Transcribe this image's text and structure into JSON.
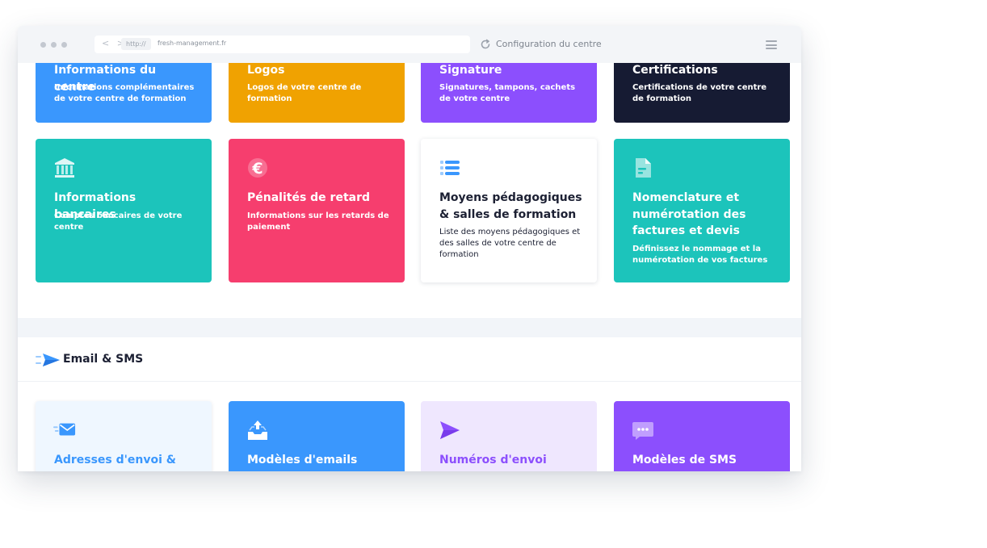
{
  "browser": {
    "protocol": "http://",
    "domain": "fresh-management.fr",
    "page_title": "Configuration du centre"
  },
  "colors": {
    "blue": "#3a97fd",
    "orange": "#f0a201",
    "purple": "#8c4ffd",
    "navy": "#161b33",
    "teal": "#1cc4bb",
    "pink": "#f63e6e",
    "light_blue": "#eff7ff",
    "lavender": "#efe7fe"
  },
  "top_cards": [
    {
      "title": "Informations du centre",
      "desc": "Informations complémentaires de votre centre de formation"
    },
    {
      "title": "Logos",
      "desc": "Logos de votre centre de formation"
    },
    {
      "title": "Signature",
      "desc": "Signatures, tampons, cachets de votre centre"
    },
    {
      "title": "Certifications",
      "desc": "Certifications de votre centre de formation"
    }
  ],
  "mid_cards": [
    {
      "title": "Informations bancaires",
      "desc": "Comptes bancaires de votre centre",
      "icon": "bank-icon"
    },
    {
      "title": "Pénalités de retard",
      "desc": "Informations sur les retards de paiement",
      "icon": "euro-icon"
    },
    {
      "title": "Moyens pédagogiques & salles de formation",
      "desc": "Liste des moyens pédagogiques et des salles de votre centre de formation",
      "icon": "list-icon"
    },
    {
      "title": "Nomenclature et numérotation des factures et devis",
      "desc": "Définissez le nommage et la numérotation de vos factures",
      "icon": "document-icon"
    }
  ],
  "section": {
    "title": "Email & SMS",
    "icon": "paper-plane-icon"
  },
  "email_cards": [
    {
      "title": "Adresses d'envoi &",
      "icon": "email-icon"
    },
    {
      "title": "Modèles d'emails",
      "icon": "inbox-upload-icon"
    },
    {
      "title": "Numéros d'envoi",
      "icon": "send-icon"
    },
    {
      "title": "Modèles de SMS",
      "icon": "chat-bubble-icon"
    }
  ]
}
